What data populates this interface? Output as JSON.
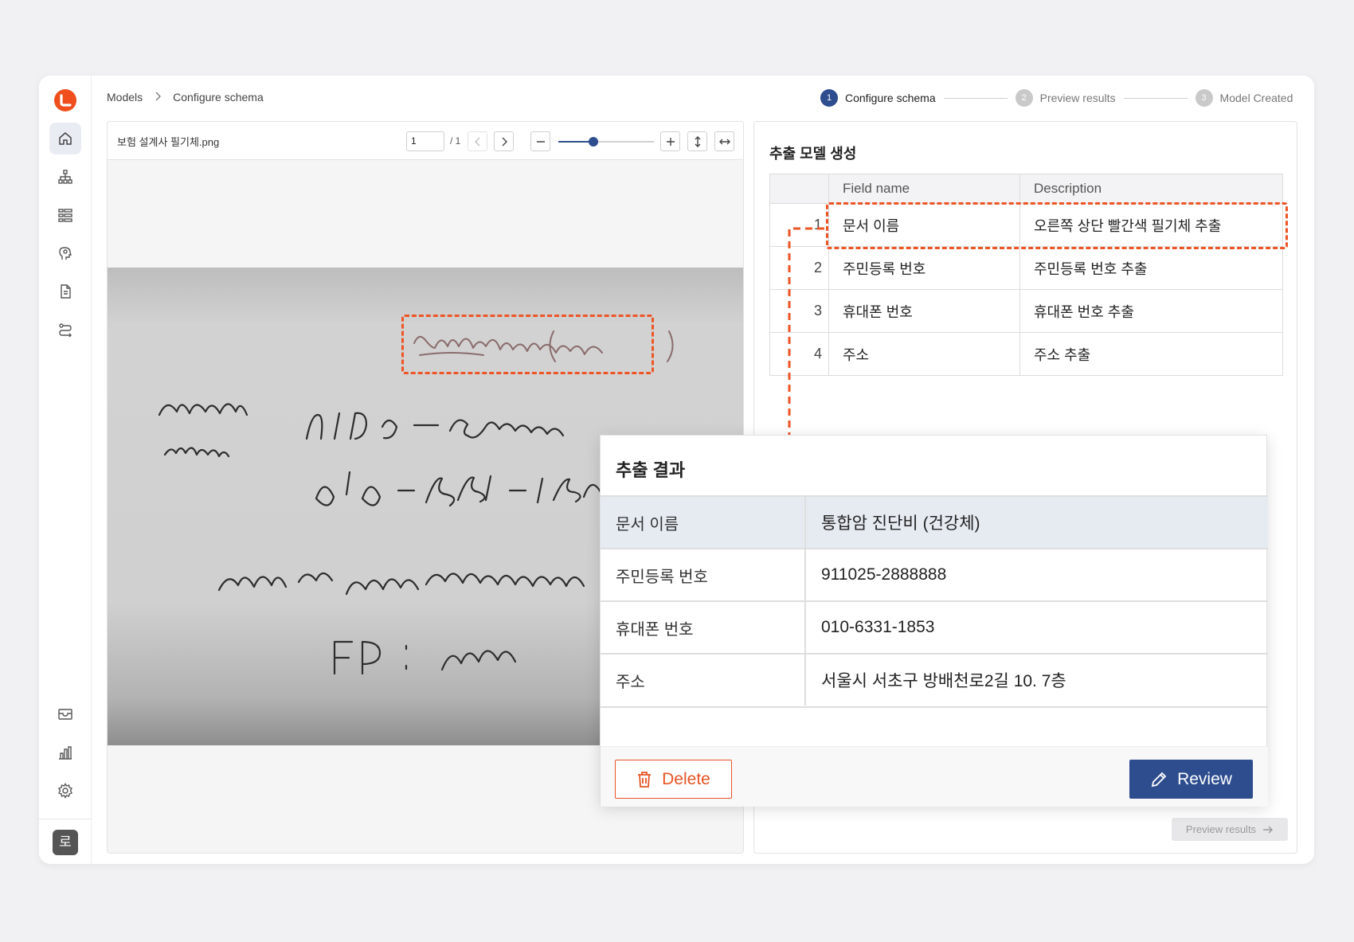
{
  "breadcrumb": {
    "root": "Models",
    "current": "Configure schema"
  },
  "stepper": [
    {
      "num": "1",
      "label": "Configure schema",
      "state": "active"
    },
    {
      "num": "2",
      "label": "Preview results",
      "state": "inactive"
    },
    {
      "num": "3",
      "label": "Model Created",
      "state": "inactive"
    }
  ],
  "sidebar": {
    "items": [
      "home-icon",
      "hierarchy-icon",
      "grid-icon",
      "ai-head-icon",
      "document-icon",
      "workflow-icon",
      "inbox-icon",
      "chart-icon",
      "settings-icon"
    ],
    "avatar_initial": "로"
  },
  "viewer": {
    "file_name": "보험 설계사 필기체.png",
    "page_value": "1",
    "page_total": "/ 1",
    "zoom_level": 0.37
  },
  "schema": {
    "title": "추출 모델 생성",
    "headers": {
      "name": "Field name",
      "description": "Description"
    },
    "rows": [
      {
        "num": "1",
        "name": "문서 이름",
        "description": "오른쪽 상단 빨간색 필기체 추출"
      },
      {
        "num": "2",
        "name": "주민등록 번호",
        "description": "주민등록 번호 추출"
      },
      {
        "num": "3",
        "name": "휴대폰 번호",
        "description": "휴대폰 번호 추출"
      },
      {
        "num": "4",
        "name": "주소",
        "description": "주소 추출"
      }
    ],
    "preview_button": "Preview results"
  },
  "result": {
    "title": "추출 결과",
    "rows": [
      {
        "key": "문서 이름",
        "value": "통합암 진단비 (건강체)"
      },
      {
        "key": "주민등록 번호",
        "value": "911025-2888888"
      },
      {
        "key": "휴대폰 번호",
        "value": "010-6331-1853"
      },
      {
        "key": "주소",
        "value": "서울시 서초구 방배천로2길 10. 7층"
      }
    ],
    "delete_label": "Delete",
    "review_label": "Review"
  },
  "colors": {
    "accent": "#2d4d8f",
    "highlight": "#ee5526",
    "brand": "#f04e1c"
  }
}
